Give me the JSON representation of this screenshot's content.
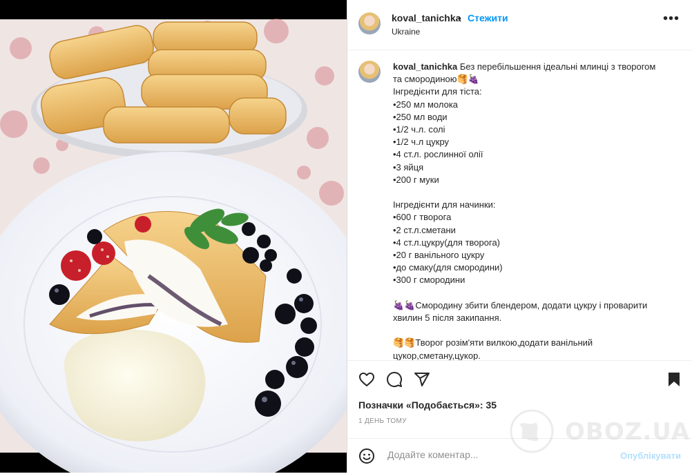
{
  "post": {
    "username": "koval_tanichka",
    "separator": "•",
    "follow_label": "Стежити",
    "location": "Ukraine",
    "more_label": "•••"
  },
  "caption": {
    "username": "koval_tanichka",
    "lines": [
      "Без перебільшення ідеальні млинці з творогом",
      "та смородиною🥞🍇",
      "Інгредієнти для тіста:",
      "•250 мл молока",
      "•250 мл води",
      "•1/2 ч.л. солі",
      "•1/2 ч.л цукру",
      "•4 ст.л. рослинної олії",
      "•3 яйця",
      "•200 г муки",
      "",
      "Інгредієнти для начинки:",
      "•600 г творога",
      "•2 ст.л.сметани",
      "•4 ст.л.цукру(для творога)",
      "•20 г ванільного цукру",
      "•до смаку(для смородини)",
      "•300 г смородини",
      "",
      "🍇🍇Смородину збити блендером, додати цукру і проварити",
      "хвилин 5 після закипання.",
      "",
      "🥞🥞Творог розім'яти вилкою,додати ванільний",
      "цукор,сметану,цукор."
    ]
  },
  "actions": {
    "likes_text": "Позначки «Подобається»: 35",
    "date": "1 ДЕНЬ ТОМУ"
  },
  "comment": {
    "placeholder": "Додайте коментар...",
    "publish_label": "Опублікувати"
  },
  "watermark": {
    "text": "OBOZ.UA"
  },
  "colors": {
    "link": "#0095f6",
    "text": "#262626",
    "muted": "#8e8e8e",
    "publish_disabled": "#b2dffc"
  }
}
